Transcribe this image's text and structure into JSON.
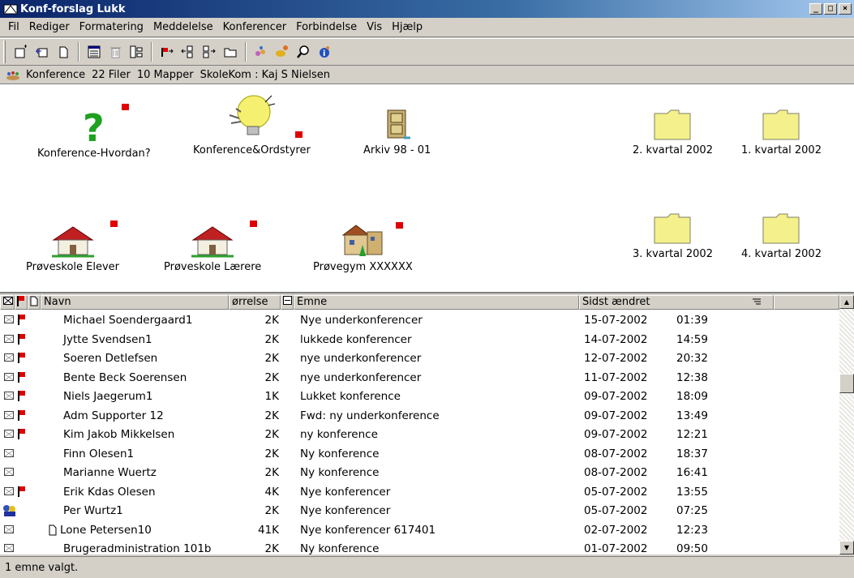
{
  "window": {
    "title": "Konf-forslag Lukk",
    "min": "_",
    "max": "□",
    "close": "×"
  },
  "menu": [
    "Fil",
    "Rediger",
    "Formatering",
    "Meddelelse",
    "Konferencer",
    "Forbindelse",
    "Vis",
    "Hjælp"
  ],
  "locbar": {
    "type": "Konference",
    "files": "22 Filer",
    "folders": "10 Mapper",
    "path": "SkoleKom : Kaj S Nielsen"
  },
  "icons": [
    {
      "label": "Konference-Hvordan?",
      "kind": "question-icon"
    },
    {
      "label": "Konference&Ordstyrer",
      "kind": "lightbulb-icon"
    },
    {
      "label": "Arkiv 98 - 01",
      "kind": "cabinet-icon"
    },
    {
      "label": "Prøveskole Elever",
      "kind": "house-icon"
    },
    {
      "label": "Prøveskole Lærere",
      "kind": "house-icon"
    },
    {
      "label": "Prøvegym XXXXXX",
      "kind": "building-icon"
    },
    {
      "label": "2. kvartal 2002",
      "kind": "folder-icon"
    },
    {
      "label": "1. kvartal 2002",
      "kind": "folder-icon"
    },
    {
      "label": "3. kvartal 2002",
      "kind": "folder-icon"
    },
    {
      "label": "4. kvartal 2002",
      "kind": "folder-icon"
    }
  ],
  "columns": {
    "name": "Navn",
    "size": "ørrelse",
    "subject": "Emne",
    "modified": "Sidst ændret"
  },
  "rows": [
    {
      "name": "Michael Soendergaard1",
      "size": "2K",
      "subject": "Nye underkonferencer",
      "date": "15-07-2002",
      "time": "01:39",
      "flag": true
    },
    {
      "name": "Jytte Svendsen1",
      "size": "2K",
      "subject": "lukkede konferencer",
      "date": "14-07-2002",
      "time": "14:59",
      "flag": true
    },
    {
      "name": "Soeren Detlefsen",
      "size": "2K",
      "subject": "nye underkonferencer",
      "date": "12-07-2002",
      "time": "20:32",
      "flag": true
    },
    {
      "name": "Bente Beck Soerensen",
      "size": "2K",
      "subject": "nye underkonferencer",
      "date": "11-07-2002",
      "time": "12:38",
      "flag": true
    },
    {
      "name": "Niels Jaegerum1",
      "size": "1K",
      "subject": "Lukket konference",
      "date": "09-07-2002",
      "time": "18:09",
      "flag": true
    },
    {
      "name": "Adm Supporter 12",
      "size": "2K",
      "subject": "Fwd: ny underkonference",
      "date": "09-07-2002",
      "time": "13:49",
      "flag": true
    },
    {
      "name": "Kim Jakob Mikkelsen",
      "size": "2K",
      "subject": "ny konference",
      "date": "09-07-2002",
      "time": "12:21",
      "flag": true
    },
    {
      "name": "Finn Olesen1",
      "size": "2K",
      "subject": "Ny konference",
      "date": "08-07-2002",
      "time": "18:37",
      "flag": false
    },
    {
      "name": "Marianne Wuertz",
      "size": "2K",
      "subject": "Ny konference",
      "date": "08-07-2002",
      "time": "16:41",
      "flag": false
    },
    {
      "name": "Erik Kdas Olesen",
      "size": "4K",
      "subject": "Nye konferencer",
      "date": "05-07-2002",
      "time": "13:55",
      "flag": true
    },
    {
      "name": "Per Wurtz1",
      "size": "2K",
      "subject": "Nye konferencer",
      "date": "05-07-2002",
      "time": "07:25",
      "flag": false,
      "special": true
    },
    {
      "name": "Lone Petersen10",
      "size": "41K",
      "subject": "Nye konferencer 617401",
      "date": "02-07-2002",
      "time": "12:23",
      "flag": false,
      "attach": true
    },
    {
      "name": "Brugeradministration 101b",
      "size": "2K",
      "subject": "Ny konference",
      "date": "01-07-2002",
      "time": "09:50",
      "flag": false
    }
  ],
  "status": "1 emne valgt."
}
